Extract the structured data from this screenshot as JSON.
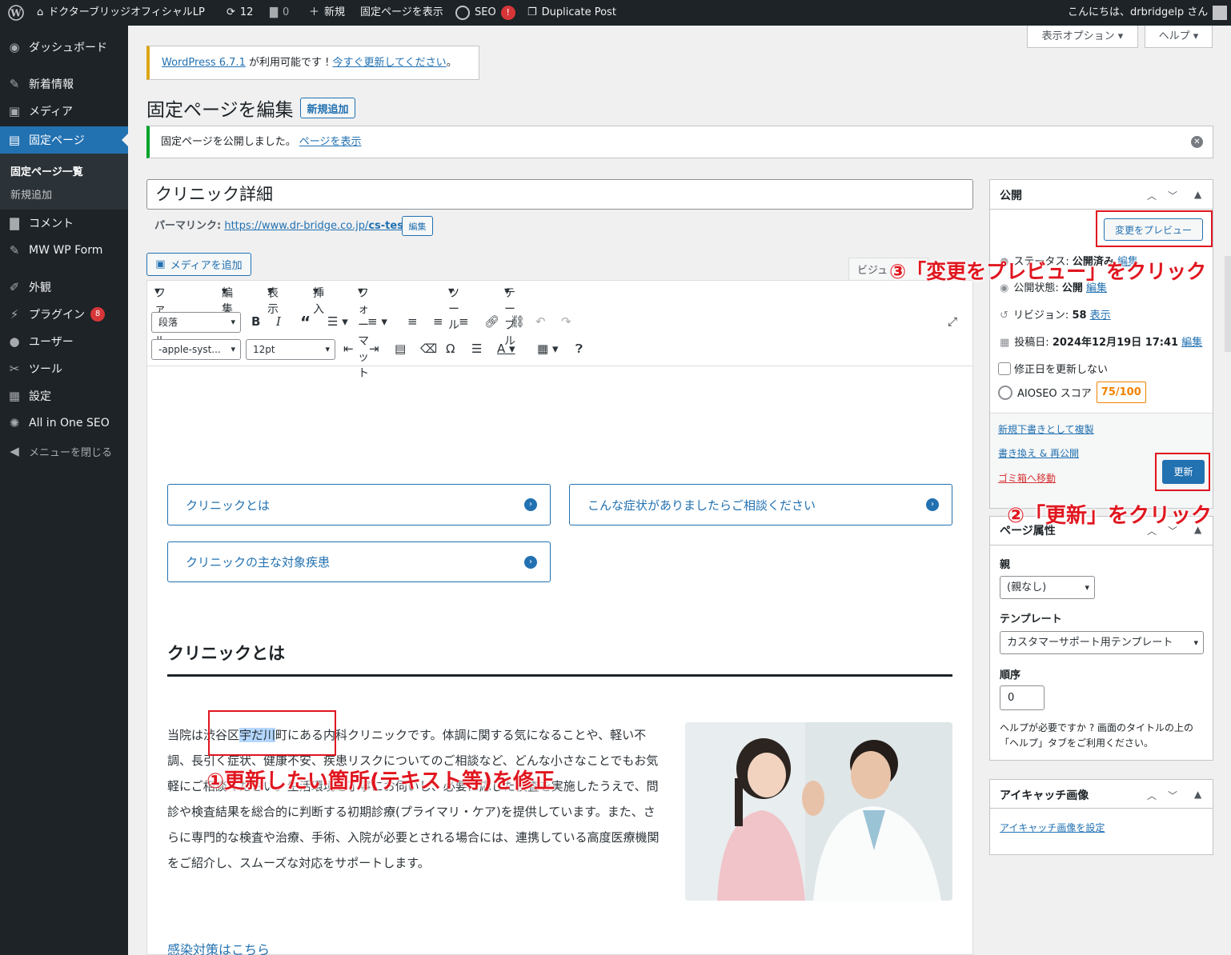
{
  "adminbar": {
    "site_name": "ドクターブリッジオフィシャルLP",
    "updates_count": "12",
    "comments_count": "0",
    "new_label": "新規",
    "view_page_label": "固定ページを表示",
    "seo_label": "SEO",
    "seo_badge": "!",
    "duplicate_label": "Duplicate Post",
    "greeting": "こんにちは、drbridgelp さん"
  },
  "sidebar": {
    "items": [
      {
        "label": "ダッシュボード",
        "icon": "dashboard-icon"
      },
      {
        "label": "新着情報",
        "icon": "pin-icon"
      },
      {
        "label": "メディア",
        "icon": "media-icon"
      },
      {
        "label": "固定ページ",
        "icon": "page-icon"
      },
      {
        "label": "コメント",
        "icon": "comment-icon"
      },
      {
        "label": "MW WP Form",
        "icon": "pin-icon"
      },
      {
        "label": "外観",
        "icon": "brush-icon"
      },
      {
        "label": "プラグイン",
        "icon": "plugin-icon",
        "count": "8"
      },
      {
        "label": "ユーザー",
        "icon": "user-icon"
      },
      {
        "label": "ツール",
        "icon": "wrench-icon"
      },
      {
        "label": "設定",
        "icon": "settings-icon"
      },
      {
        "label": "All in One SEO",
        "icon": "aioseo-icon"
      },
      {
        "label": "メニューを閉じる",
        "icon": "collapse-icon"
      }
    ],
    "submenu": [
      "固定ページ一覧",
      "新規追加"
    ]
  },
  "screen_options": "表示オプション",
  "help": "ヘルプ",
  "update_notice": {
    "link1": "WordPress 6.7.1",
    "mid": " が利用可能です ! ",
    "link2": "今すぐ更新してください",
    "end": "。"
  },
  "heading": {
    "title": "固定ページを編集",
    "add_new": "新規追加"
  },
  "notice": {
    "text": "固定ページを公開しました。",
    "link": "ページを表示"
  },
  "post": {
    "title": "クリニック詳細",
    "permalink_label": "パーマリンク:",
    "permalink_base": "https://www.dr-bridge.co.jp/",
    "permalink_slug": "cs-test/",
    "edit": "編集"
  },
  "editor": {
    "add_media": "メディアを追加",
    "visual_tab": "ビジュ",
    "menus": [
      "ファイル",
      "編集",
      "表示",
      "挿入",
      "フォーマット",
      "ツール",
      "テーブル"
    ],
    "format_select": "段落",
    "font_select": "-apple-syst...",
    "size_select": "12pt"
  },
  "content": {
    "links": [
      "クリニックとは",
      "こんな症状がありましたらご相談ください",
      "クリニックの主な対象疾患"
    ],
    "section_heading": "クリニックとは",
    "para_pre": "当院は渋谷区",
    "para_sel": "宇だ川",
    "para_post": "町にある内科クリニックです。体調に関する気になることや、軽い不調、長引く症状、健康不安、疾患リスクについてのご相談など、どんな小さなことでもお気軽にご相談ください。生活環境を丁寧にお伺いし、必要に応じた検査を実施したうえで、問診や検査結果を総合的に判断する初期診療(プライマリ・ケア)を提供しています。また、さらに専門的な検査や治療、手術、入院が必要とされる場合には、連携している高度医療機関をご紹介し、スムーズな対応をサポートします。",
    "bottom_link": "感染対策はこちら"
  },
  "publish": {
    "title": "公開",
    "preview": "変更をプレビュー",
    "status_label": "ステータス:",
    "status_value": "公開済み",
    "status_edit": "編集",
    "visibility_label": "公開状態:",
    "visibility_value": "公開",
    "visibility_edit": "編集",
    "revisions_label": "リビジョン:",
    "revisions_value": "58",
    "revisions_link": "表示",
    "date_label": "投稿日:",
    "date_value": "2024年12月19日 17:41",
    "date_edit": "編集",
    "nomodify": "修正日を更新しない",
    "aioseo_label": "AIOSEO スコア",
    "aioseo_score": "75/100",
    "copy_draft": "新規下書きとして複製",
    "rewrite": "書き換え & 再公開",
    "trash": "ゴミ箱へ移動",
    "update": "更新"
  },
  "page_attr": {
    "title": "ページ属性",
    "parent_label": "親",
    "parent_value": "(親なし)",
    "template_label": "テンプレート",
    "template_value": "カスタマーサポート用テンプレート",
    "order_label": "順序",
    "order_value": "0",
    "help_text": "ヘルプが必要ですか ? 画面のタイトルの上の「ヘルプ」タブをご利用ください。"
  },
  "featured": {
    "title": "アイキャッチ画像",
    "link": "アイキャッチ画像を設定"
  },
  "annotations": {
    "a1": "①更新したい箇所(テキスト等)を修正",
    "a2": "②「更新」をクリック",
    "a3": "③「変更をプレビュー」をクリック"
  }
}
